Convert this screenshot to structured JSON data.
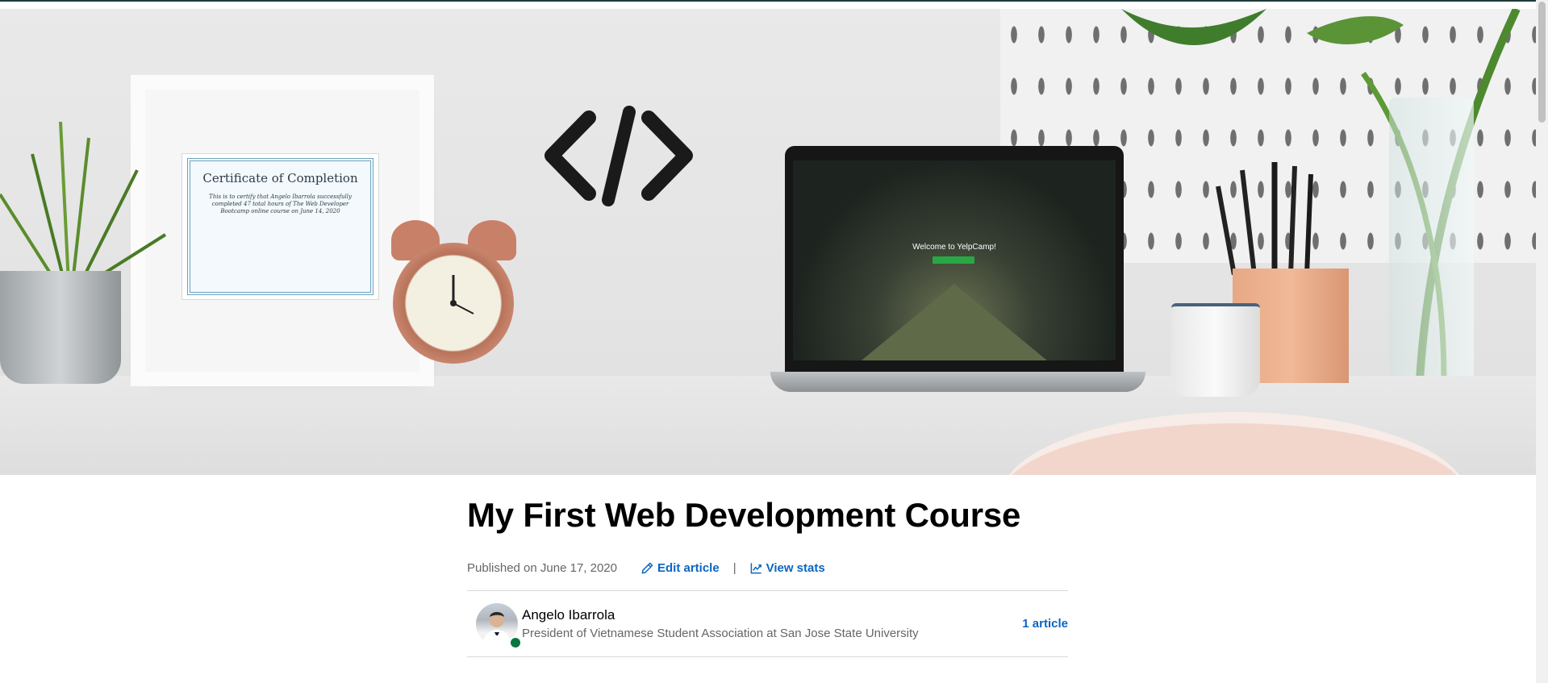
{
  "article": {
    "title": "My First Web Development Course",
    "published": "Published on June 17, 2020",
    "edit_label": "Edit article",
    "separator": "|",
    "stats_label": "View stats"
  },
  "author": {
    "name": "Angelo Ibarrola",
    "headline": "President of Vietnamese Student Association at San Jose State University",
    "article_count": "1 article",
    "online": true
  },
  "cover": {
    "certificate_title": "Certificate of Completion",
    "certificate_body": "This is to certify that Angelo Ibarrola successfully completed 47 total hours of The Web Developer Bootcamp online course on June 14, 2020",
    "laptop_text": "Welcome to YelpCamp!"
  },
  "colors": {
    "link": "#0a66c2",
    "muted": "#666666",
    "presence": "#057642",
    "divider": "#d9d9d9"
  },
  "icons": {
    "edit": "pencil-icon",
    "stats": "line-chart-icon"
  }
}
